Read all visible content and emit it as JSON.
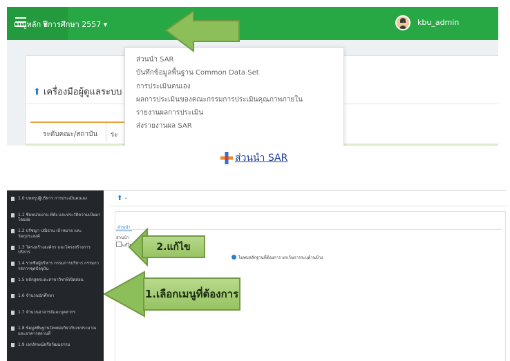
{
  "top_screenshot": {
    "navbar": {
      "menu_icon": "hamburger-icon",
      "academic_year": "ปีการศึกษา 2557 ▾",
      "main_menu": "เมนูหลัก ▾",
      "user_icon": "user-avatar-icon",
      "username": "kbu_admin"
    },
    "dropdown": {
      "items": [
        "ส่วนนำ SAR",
        "บันทึกข้อมูลพื้นฐาน Common Data Set",
        "การประเมินตนเอง",
        "ผลการประเมินของคณะกรรมการประเมินคุณภาพภายใน",
        "รายงานผลการประเมิน",
        "ส่งรายงานผล SAR"
      ]
    },
    "tool_title": "เครื่องมือผู้ดูแลระบบ",
    "tool_icon": "upload-icon",
    "tabs": {
      "left": "ระดับคณะ/สถาบัน",
      "right": "ระ"
    },
    "colors": {
      "navbar_green": "#27a844",
      "arrow_green": "#8cbf5a"
    }
  },
  "caption": {
    "icon": "plus-icon",
    "text": "ส่วนนำ SAR"
  },
  "bottom_screenshot": {
    "sidebar_items": [
      "1.0 บทสรุปผู้บริหาร การประเมินตนเอง",
      "1.1 ชื่อหน่วยงาน ที่ตั้ง และประวัติความเป็นมาโดยย่อ",
      "1.2 ปรัชญา ปณิธาน เป้าหมาย และวัตถุประสงค์",
      "1.3 โครงสร้างองค์กร และโครงสร้างการบริหาร",
      "1.4 รายชื่อผู้บริหาร กรรมการบริหาร กรรมการสภาฯชุดปัจจุบัน",
      "1.5 หลักสูตรและสาขาวิชาที่เปิดสอน",
      "1.6 จำนวนนักศึกษา",
      "1.7 จำนวนอาจารย์และบุคลากร",
      "1.8 ข้อมูลพื้นฐานโดยย่อเกี่ยวกับงบประมาณ และอาคารสถานที่",
      "1.9 เอกลักษณ์หรือวัฒนธรรม"
    ],
    "main_top_icon": "upload-icon",
    "main_top_text": "-",
    "inner_tab": "ส่วนนำ",
    "inner_label": "ส่วนนำ",
    "edit_link": "แก้ไข",
    "info_text": "ไม่พบหลักฐานที่ต้องการ ยกเว้นการระบุด้านข้าง",
    "callouts": {
      "edit": "2.แก้ไข",
      "menu": "1.เลือกเมนูที่ต้องการ"
    }
  }
}
